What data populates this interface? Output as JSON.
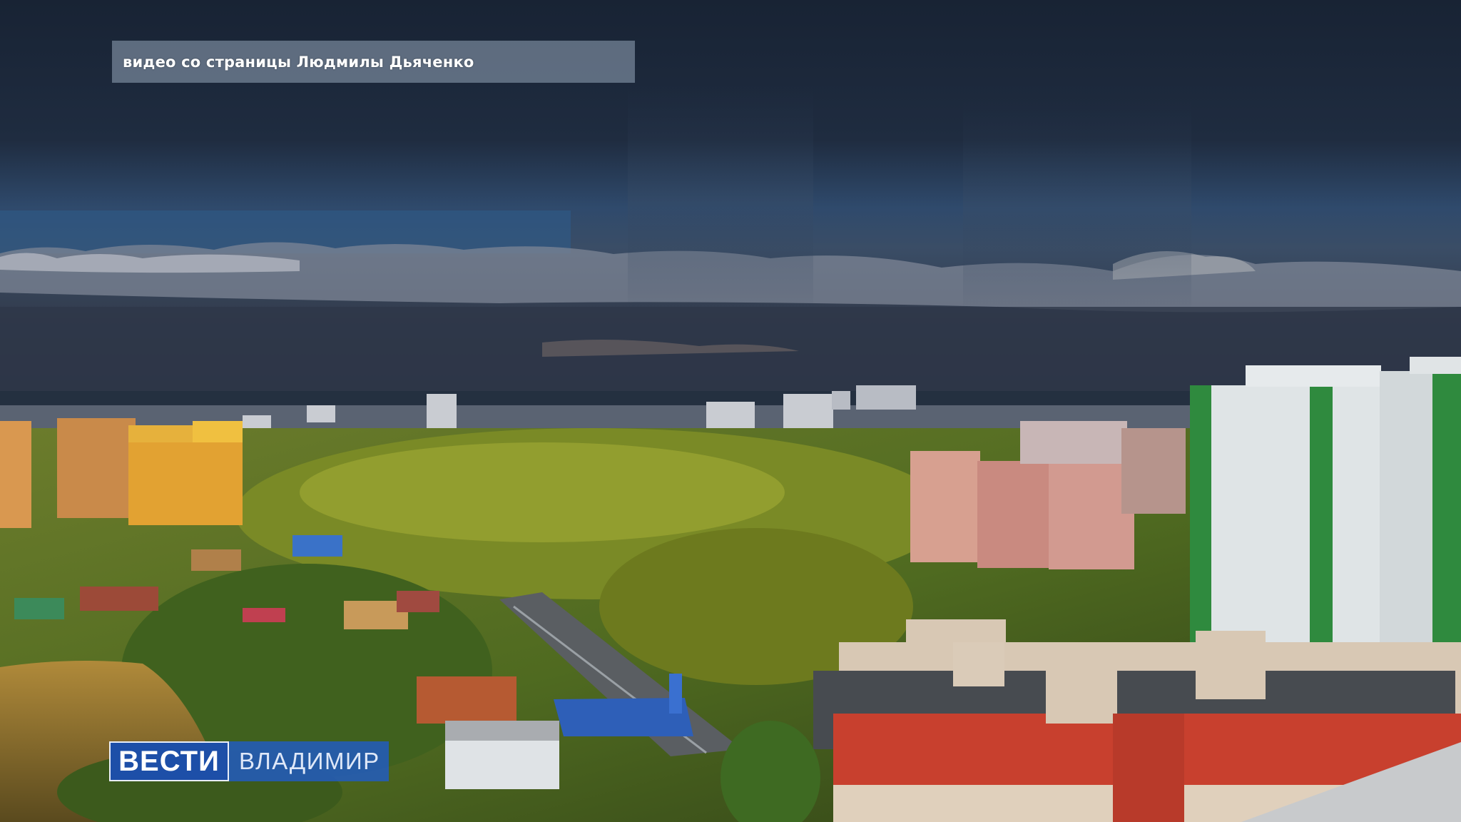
{
  "overlay": {
    "caption": "видео со страницы Людмилы Дьяченко"
  },
  "logo": {
    "main": "ВЕСТИ",
    "sub": "ВЛАДИМИР"
  },
  "colors": {
    "storm_sky": "#1f2c40",
    "greenery": "#6f8a2a",
    "brand_blue": "#1d4fa8"
  }
}
